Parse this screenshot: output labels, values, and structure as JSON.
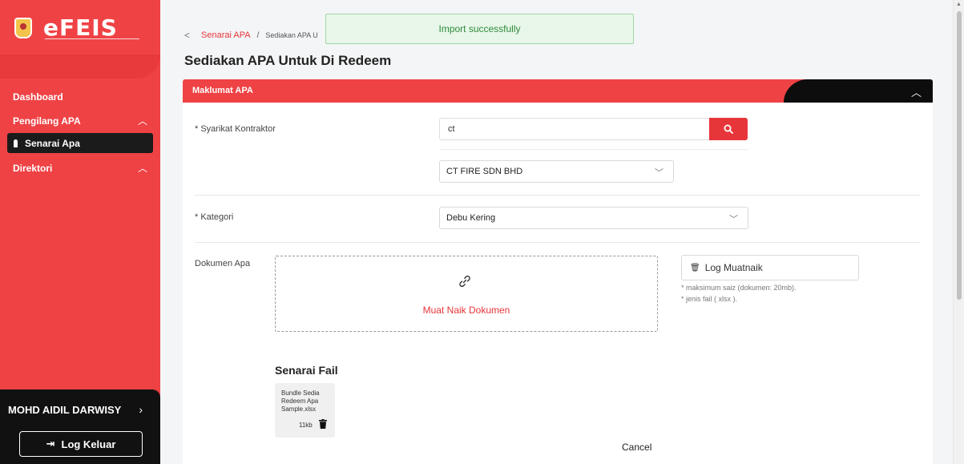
{
  "app": {
    "logo_text": "eFEIS",
    "toast_message": "Import successfully"
  },
  "sidebar": {
    "items": [
      {
        "label": "Dashboard"
      },
      {
        "label": "Pengilang APA",
        "chevron": "^"
      },
      {
        "label": "Senarai Apa"
      },
      {
        "label": "Direktori",
        "chevron": "^"
      }
    ],
    "user_name": "MOHD AIDIL DARWISY",
    "logout_label": "Log Keluar"
  },
  "breadcrumb": {
    "back": "<",
    "link": "Senarai APA",
    "separator": "/",
    "current": "Sediakan APA U"
  },
  "page": {
    "title": "Sediakan APA Untuk Di Redeem"
  },
  "card": {
    "header_title": "Maklumat APA",
    "collapse_icon": "^"
  },
  "form": {
    "contractor_label": "* Syarikat Kontraktor",
    "contractor_search_value": "ct",
    "contractor_select_value": "CT FIRE SDN BHD",
    "category_label": "* Kategori",
    "category_select_value": "Debu Kering",
    "document_label": "Dokumen Apa",
    "upload_text": "Muat Naik Dokumen",
    "log_button_label": "Log Muatnaik",
    "hint_size": "* maksimum saiz (dokumen: 20mb).",
    "hint_type": "* jenis fail ( xlsx ).",
    "files_title": "Senarai Fail",
    "file": {
      "name": "Bundle Sedia Redeem Apa Sample.xlsx",
      "size": "11kb"
    },
    "cancel_label": "Cancel"
  },
  "colors": {
    "brand_red": "#ef4245",
    "accent_red": "#e7363a",
    "dark": "#0d0d0d",
    "toast_bg": "#e8f7ea",
    "toast_text": "#2f8a3a"
  },
  "icons": {
    "search": "search-icon",
    "link": "link-icon",
    "trash": "trash-icon",
    "logout": "logout-icon",
    "chevron_down": "chevron-down-icon"
  }
}
